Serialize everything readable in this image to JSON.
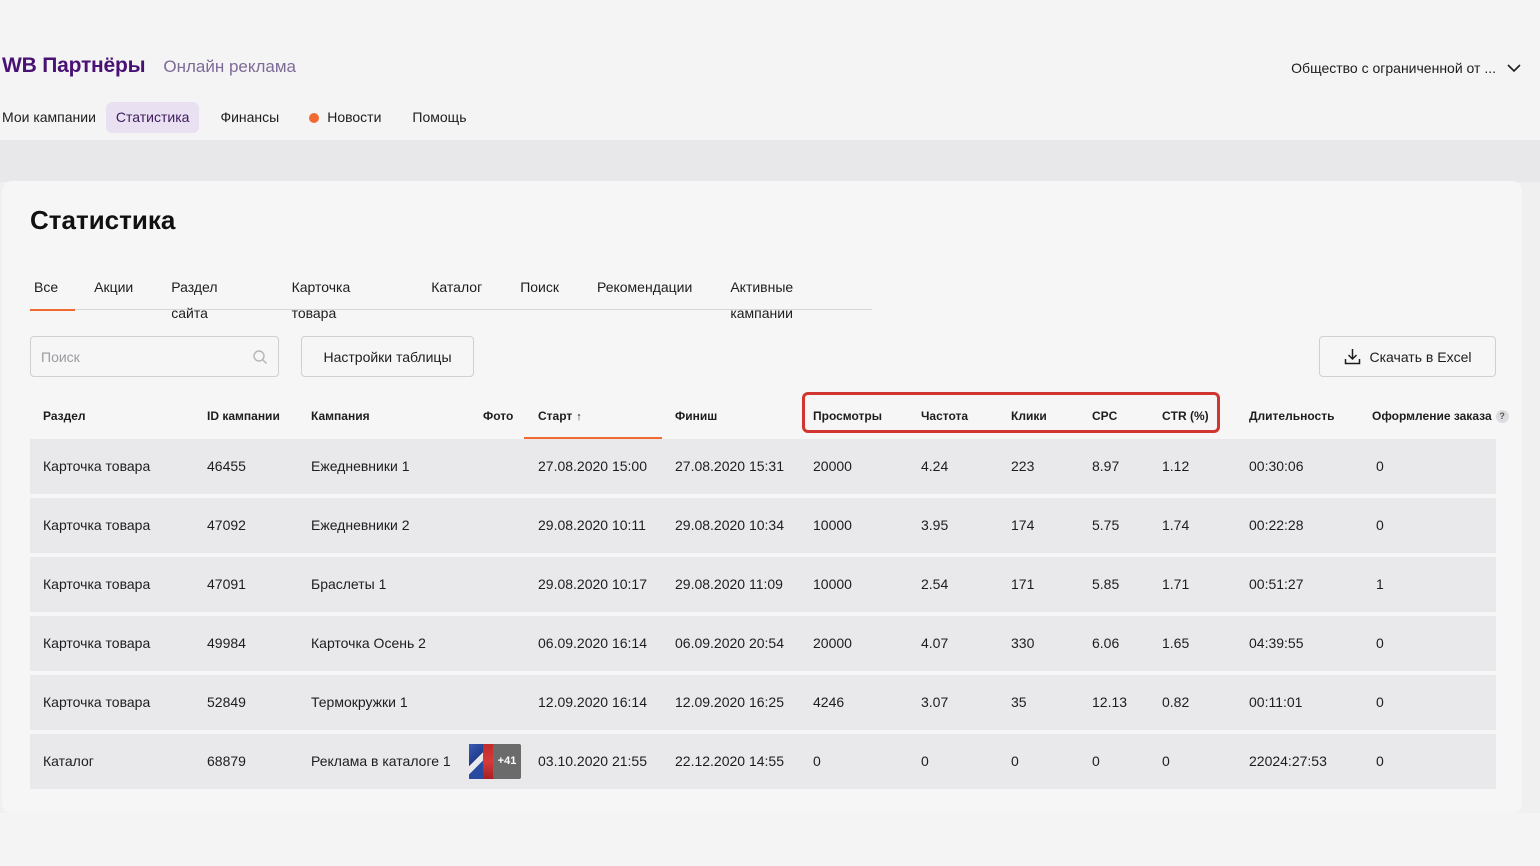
{
  "brand": {
    "name": "WB Партнёры",
    "subtitle": "Онлайн реклама"
  },
  "org": {
    "label": "Общество с ограниченной от ...",
    "icon": "chevron-down-icon"
  },
  "topnav": {
    "items": [
      {
        "label": "Мои кампании"
      },
      {
        "label": "Статистика",
        "active": true
      },
      {
        "label": "Финансы"
      },
      {
        "label": "Новости",
        "dot": true
      },
      {
        "label": "Помощь"
      }
    ]
  },
  "page": {
    "title": "Статистика"
  },
  "tabs": [
    {
      "label": "Все",
      "active": true
    },
    {
      "label": "Акции"
    },
    {
      "label": "Раздел сайта"
    },
    {
      "label": "Карточка товара"
    },
    {
      "label": "Каталог"
    },
    {
      "label": "Поиск"
    },
    {
      "label": "Рекомендации"
    },
    {
      "label": "Активные кампании"
    }
  ],
  "search": {
    "placeholder": "Поиск",
    "value": ""
  },
  "toolbar": {
    "settings_label": "Настройки таблицы",
    "excel_label": "Скачать в Excel"
  },
  "table": {
    "columns": {
      "section": "Раздел",
      "id": "ID кампании",
      "campaign": "Кампания",
      "photo": "Фото",
      "start": "Старт",
      "finish": "Финиш",
      "views": "Просмотры",
      "frequency": "Частота",
      "clicks": "Клики",
      "cpc": "CPC",
      "ctr": "CTR (%)",
      "duration": "Длительность",
      "orders": "Оформление заказа"
    },
    "sort": {
      "column": "start",
      "direction": "asc",
      "icon": "arrow-up-icon"
    },
    "rows": [
      {
        "section": "Карточка товара",
        "id": "46455",
        "campaign": "Ежедневники 1",
        "photo": "",
        "start": "27.08.2020 15:00",
        "finish": "27.08.2020 15:31",
        "views": "20000",
        "frequency": "4.24",
        "clicks": "223",
        "cpc": "8.97",
        "ctr": "1.12",
        "duration": "00:30:06",
        "orders": "0"
      },
      {
        "section": "Карточка товара",
        "id": "47092",
        "campaign": "Ежедневники 2",
        "photo": "",
        "start": "29.08.2020 10:11",
        "finish": "29.08.2020 10:34",
        "views": "10000",
        "frequency": "3.95",
        "clicks": "174",
        "cpc": "5.75",
        "ctr": "1.74",
        "duration": "00:22:28",
        "orders": "0"
      },
      {
        "section": "Карточка товара",
        "id": "47091",
        "campaign": "Браслеты 1",
        "photo": "",
        "start": "29.08.2020 10:17",
        "finish": "29.08.2020 11:09",
        "views": "10000",
        "frequency": "2.54",
        "clicks": "171",
        "cpc": "5.85",
        "ctr": "1.71",
        "duration": "00:51:27",
        "orders": "1"
      },
      {
        "section": "Карточка товара",
        "id": "49984",
        "campaign": "Карточка Осень 2",
        "photo": "",
        "start": "06.09.2020 16:14",
        "finish": "06.09.2020 20:54",
        "views": "20000",
        "frequency": "4.07",
        "clicks": "330",
        "cpc": "6.06",
        "ctr": "1.65",
        "duration": "04:39:55",
        "orders": "0"
      },
      {
        "section": "Карточка товара",
        "id": "52849",
        "campaign": "Термокружки 1",
        "photo": "",
        "start": "12.09.2020 16:14",
        "finish": "12.09.2020 16:25",
        "views": "4246",
        "frequency": "3.07",
        "clicks": "35",
        "cpc": "12.13",
        "ctr": "0.82",
        "duration": "00:11:01",
        "orders": "0"
      },
      {
        "section": "Каталог",
        "id": "68879",
        "campaign": "Реклама в каталоге 1",
        "photo": "+41",
        "start": "03.10.2020 21:55",
        "finish": "22.12.2020 14:55",
        "views": "0",
        "frequency": "0",
        "clicks": "0",
        "cpc": "0",
        "ctr": "0",
        "duration": "22024:27:53",
        "orders": "0"
      }
    ]
  },
  "colors": {
    "brand": "#481173",
    "accent": "#f06a32",
    "highlight": "#d0362f",
    "nav_active_bg": "#e9e0f2"
  }
}
